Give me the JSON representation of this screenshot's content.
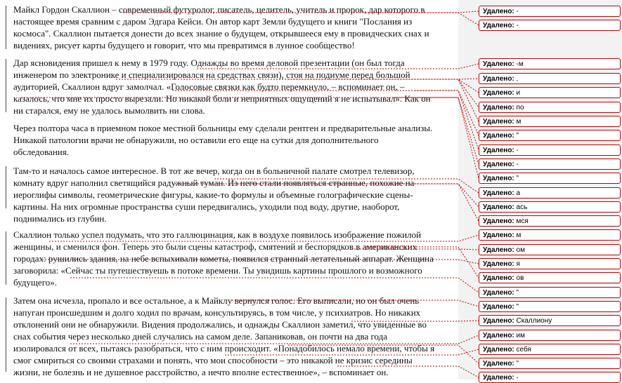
{
  "document": {
    "paragraphs": [
      {
        "lines": [
          "Майкл Гордон Скаллион – современный футуролог, писатель, целитель, учитель и пророк, дар которого в",
          "настоящее время сравним с даром Эдгара Кейси. Он автор карт Земли будущего и книги \"Послания из",
          "космоса\". Скаллион пытается донести до всех знание о будущем, открывшееся ему в провидческих снах и",
          "видениях, рисует карты будущего и говорит, что мы превратимся в лунное сообщество!"
        ]
      },
      {
        "lines": [
          "Дар ясновидения пришел к нему в 1979 году. Однажды во время деловой презентации (он был тогда",
          "инженером по электронике и специализировался на средствах связи), стоя на подиуме перед большой",
          "аудиторией, Скаллион вдруг замолчал. «Голосовые связки как будто перемкнуло, – вспоминает он, –",
          "казалось, что мне их просто вырезали. Но никакой боли и неприятных ощущений я не испытывал». Как он",
          "ни старался, ему не удалось вымолвить ни слова."
        ]
      },
      {
        "lines": [
          "Через полтора часа в приемном покое местной больницы ему сделали рентген и предварительные анализы.",
          "Никакой патологии врачи не обнаружили, но оставили его еще на сутки для дополнительного",
          "обследования."
        ]
      },
      {
        "lines": [
          "Там-то и началось самое интересное. В тот же вечер, когда он в больничной палате смотрел телевизор,",
          "комнату вдруг наполнил светящийся радужный туман. Из него стали появляться странные, похожие на",
          "иероглифы символы, геометрические фигуры, какие-то формулы и объемные голографические сцены-",
          "картины. На них огромные пространства суши передвигались, уходили под воду, другие, наоборот,",
          "поднимались из глубин."
        ]
      },
      {
        "lines": [
          "Скаллион только успел подумать, что это галлюцинация, как в воздухе появилось изображение пожилой",
          "женщины, и сменился фон. Теперь это были сцены катастроф, смятений и беспорядков в американских",
          "городах: рушились здания, на небе вспыхивали кометы, появился странный летательный аппарат. Женщина",
          "заговорила: «Сейчас ты путешествуешь в потоке времени. Ты увидишь картины прошлого и возможного",
          "будущего»."
        ]
      },
      {
        "lines": [
          "Затем она исчезла, пропало и все остальное, а к Майклу вернулся голос. Его выписали, но он был очень",
          "напуган происшедшим и долго ходил по врачам, консультируясь, в том числе, у психиатров. Но никаких",
          "отклонений они не обнаружили. Видения продолжались, и однажды Скаллион заметил, что увиденные во",
          "снах события через несколько дней случались на самом деле. Запаниковав, он почти на два года",
          "изолировался от всех, пытаясь разобраться, что с ним происходит. «Понадобилось немало времени, чтобы я",
          "смог смириться со своими страхами и понять, что мои способности – это никакой не кризис середины",
          "жизни, не болезнь и не душевное расстройство, а нечто вполне естественное», – вспоминает он."
        ]
      }
    ]
  },
  "margin": {
    "label": "Удалено:",
    "balloons": [
      {
        "value": "-"
      },
      {
        "value": "-"
      },
      {
        "value": "-м"
      },
      {
        "value": ","
      },
      {
        "value": "и"
      },
      {
        "value": "по"
      },
      {
        "value": "м"
      },
      {
        "value": "\""
      },
      {
        "value": "-"
      },
      {
        "value": "-"
      },
      {
        "value": "\""
      },
      {
        "value": "а"
      },
      {
        "value": "ась"
      },
      {
        "value": "мся"
      },
      {
        "value": "м"
      },
      {
        "value": "ом"
      },
      {
        "value": "я"
      },
      {
        "value": "ов"
      },
      {
        "value": "\""
      },
      {
        "value": "\""
      },
      {
        "value": "Скаллиону"
      },
      {
        "value": "им"
      },
      {
        "value": "себя"
      },
      {
        "value": "\""
      },
      {
        "value": "-"
      }
    ]
  },
  "colors": {
    "markup": "#c00000",
    "margin_bg": "#f2f2f2"
  }
}
